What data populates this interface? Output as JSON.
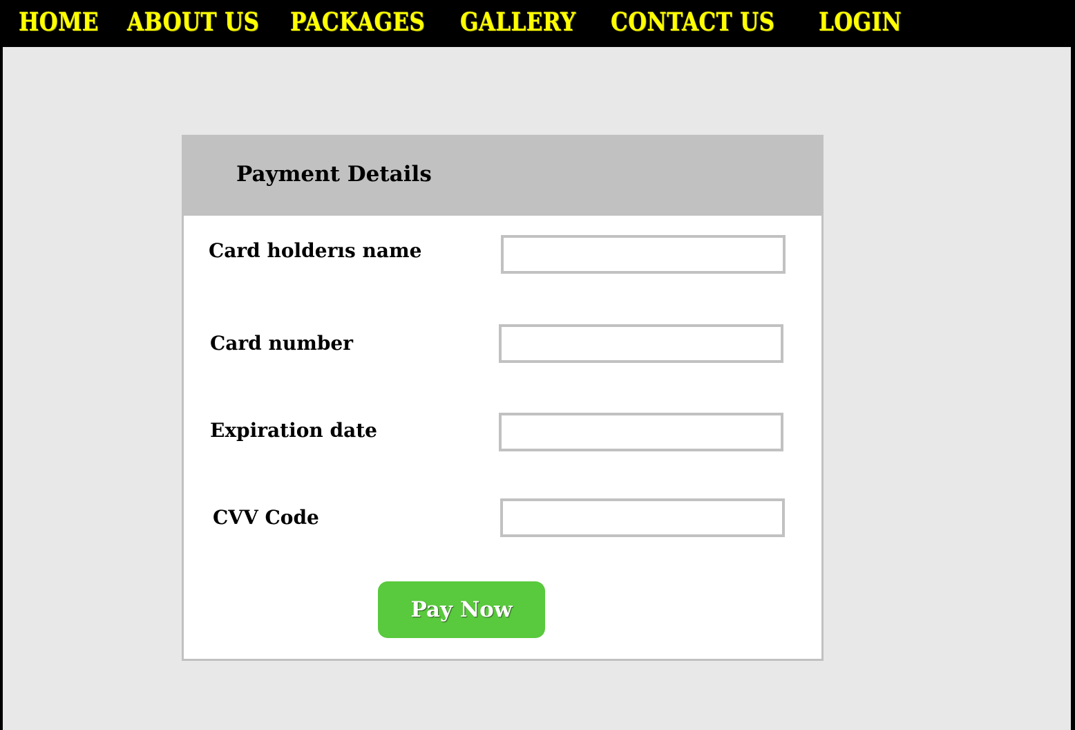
{
  "nav": {
    "items": [
      {
        "label": "HOME"
      },
      {
        "label": "ABOUT US"
      },
      {
        "label": "PACKAGES"
      },
      {
        "label": "GALLERY"
      },
      {
        "label": "CONTACT US"
      },
      {
        "label": "LOGIN"
      }
    ]
  },
  "payment": {
    "title": "Payment Details",
    "fields": [
      {
        "label": "Card holderıs name",
        "value": ""
      },
      {
        "label": "Card number",
        "value": ""
      },
      {
        "label": "Expiration date",
        "value": ""
      },
      {
        "label": "CVV Code",
        "value": ""
      }
    ],
    "submit_label": "Pay Now"
  },
  "colors": {
    "nav_background": "#000000",
    "nav_text": "#ffff00",
    "page_background": "#e8e8e8",
    "panel_header": "#c1c1c1",
    "panel_border": "#c1c1c1",
    "button_background": "#59c93d",
    "button_text": "#ffffff"
  }
}
